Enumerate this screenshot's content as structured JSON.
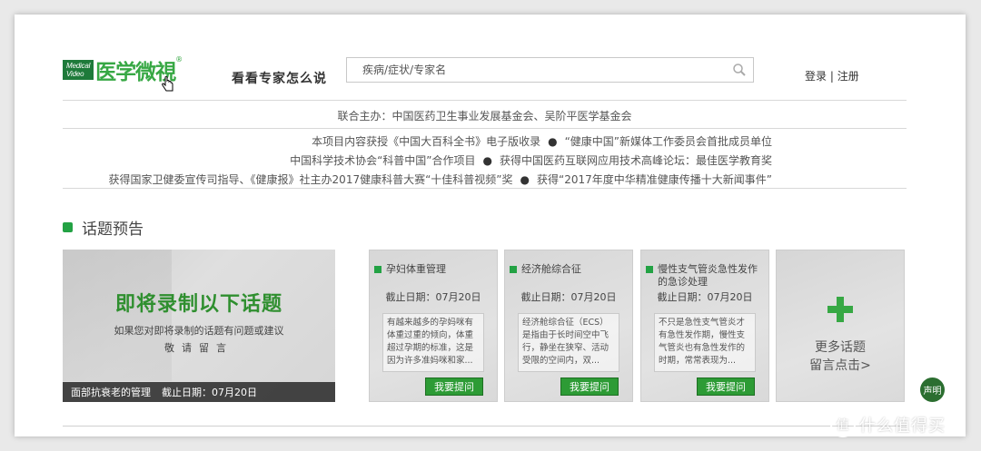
{
  "logo": {
    "box_line1": "Medical",
    "box_line2": "Video",
    "text": "医学微視",
    "reg": "®"
  },
  "slogan": "看看专家怎么说",
  "search": {
    "placeholder": "疾病/症状/专家名"
  },
  "auth": {
    "login": "登录",
    "sep": "|",
    "register": "注册"
  },
  "sponsor": "联合主办：中国医药卫生事业发展基金会、吴阶平医学基金会",
  "honors": [
    {
      "left": "本项目内容获授《中国大百科全书》电子版收录",
      "right": "“健康中国”新媒体工作委员会首批成员单位"
    },
    {
      "left": "中国科学技术协会“科普中国”合作项目",
      "right": "获得中国医药互联网应用技术高峰论坛：最佳医学教育奖"
    },
    {
      "left": "获得国家卫健委宣传司指导、《健康报》社主办2017健康科普大赛“十佳科普视频”奖",
      "right": "获得“2017年度中华精准健康传播十大新闻事件”"
    }
  ],
  "section": {
    "title": "话题预告"
  },
  "big_card": {
    "title": "即将录制以下话题",
    "sub": "如果您对即将录制的话题有问题或建议",
    "sub2": "敬请留言",
    "bar_topic": "面部抗衰老的管理",
    "bar_date": "截止日期：07月20日"
  },
  "cards": [
    {
      "title": "孕妇体重管理",
      "date": "截止日期：07月20日",
      "desc": "有越来越多的孕妈咪有体重过重的倾向，体重超过孕期的标准，这是因为许多准妈咪和家...",
      "button": "我要提问"
    },
    {
      "title": "经济舱综合征",
      "date": "截止日期：07月20日",
      "desc": "经济舱综合征（ECS）是指由于长时间空中飞行，静坐在狭窄、活动受限的空间内，双...",
      "button": "我要提问"
    },
    {
      "title": "慢性支气管炎急性发作的急诊处理",
      "date": "截止日期：07月20日",
      "desc": "不只是急性支气管炎才有急性发作期，慢性支气管炎也有急性发作的时期，常常表现为...",
      "button": "我要提问"
    }
  ],
  "more": {
    "line1": "更多话题",
    "line2": "留言点击>"
  },
  "statement": "声明",
  "watermark": "什么值得买",
  "colors": {
    "brand_green": "#37a844",
    "button_green": "#2d9b35",
    "dark_green": "#2b6e30"
  }
}
